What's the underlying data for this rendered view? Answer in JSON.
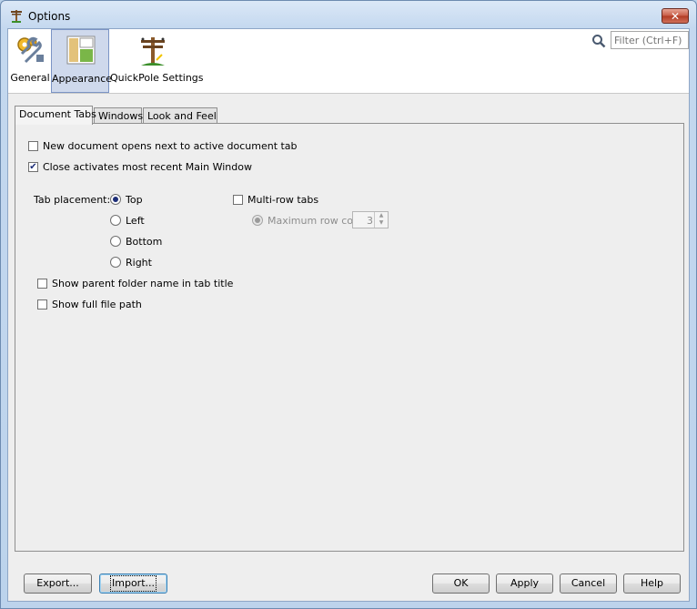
{
  "window": {
    "title": "Options",
    "close_glyph": "✕"
  },
  "categories": [
    {
      "label": "General",
      "icon": "gears-wrench-icon",
      "selected": false
    },
    {
      "label": "Appearance",
      "icon": "layout-panels-icon",
      "selected": true
    },
    {
      "label": "QuickPole Settings",
      "icon": "utility-pole-icon",
      "selected": false
    }
  ],
  "search": {
    "placeholder": "Filter (Ctrl+F)"
  },
  "tabs": [
    {
      "label": "Document Tabs",
      "active": true
    },
    {
      "label": "Windows",
      "active": false
    },
    {
      "label": "Look and Feel",
      "active": false
    }
  ],
  "document_tabs": {
    "new_doc_next": {
      "label": "New document opens next to active document tab",
      "checked": false
    },
    "close_activates": {
      "label": "Close activates most recent Main Window",
      "checked": true
    },
    "placement_label": "Tab placement:",
    "placements": [
      {
        "label": "Top",
        "selected": true
      },
      {
        "label": "Left",
        "selected": false
      },
      {
        "label": "Bottom",
        "selected": false
      },
      {
        "label": "Right",
        "selected": false
      }
    ],
    "multi_row": {
      "label": "Multi-row tabs",
      "checked": false
    },
    "max_row": {
      "label": "Maximum row count:",
      "selected": true,
      "value": "3"
    },
    "show_parent": {
      "label": "Show parent folder name in tab title",
      "checked": false
    },
    "show_full_path": {
      "label": "Show full file path",
      "checked": false
    }
  },
  "buttons": {
    "export": "Export...",
    "import": "Import...",
    "ok": "OK",
    "apply": "Apply",
    "cancel": "Cancel",
    "help": "Help"
  },
  "colors": {
    "accent": "#1d2e78",
    "selection": "#cfd9ec"
  }
}
